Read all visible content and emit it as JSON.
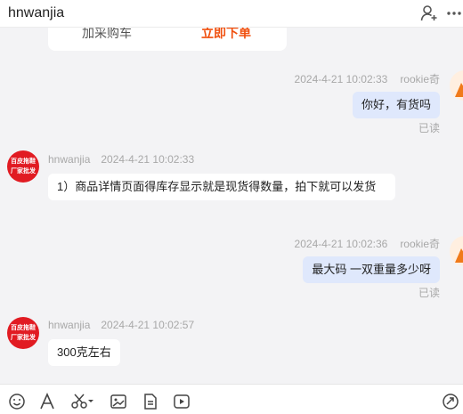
{
  "header": {
    "title": "hnwanjia",
    "icons": [
      "add-user-icon",
      "more-icon"
    ]
  },
  "product_card": {
    "cart_label": "加采购车",
    "buy_label": "立即下单"
  },
  "messages": [
    {
      "side": "out",
      "sender": "rookie奇",
      "time": "2024-4-21 10:02:33",
      "text": "你好，有货吗",
      "status": "已读"
    },
    {
      "side": "in",
      "sender": "hnwanjia",
      "time": "2024-4-21 10:02:33",
      "text": "1）商品详情页面得库存显示就是现货得数量，拍下就可以发货",
      "avatar_text": [
        "百皮拖鞋",
        "厂家批发"
      ]
    },
    {
      "side": "out",
      "sender": "rookie奇",
      "time": "2024-4-21 10:02:36",
      "text": "最大码  一双重量多少呀",
      "status": "已读"
    },
    {
      "side": "in",
      "sender": "hnwanjia",
      "time": "2024-4-21 10:02:57",
      "text": "300克左右",
      "avatar_text": [
        "百皮拖鞋",
        "厂家批发"
      ]
    }
  ],
  "toolbar": {
    "icons": [
      "emoji-icon",
      "font-icon",
      "scissors-icon",
      "image-icon",
      "file-icon",
      "video-icon",
      "share-icon"
    ]
  },
  "colors": {
    "outgoing_bubble": "#dfe8fc",
    "buy_accent": "#f0500f",
    "avatar_red": "#e11b22"
  }
}
